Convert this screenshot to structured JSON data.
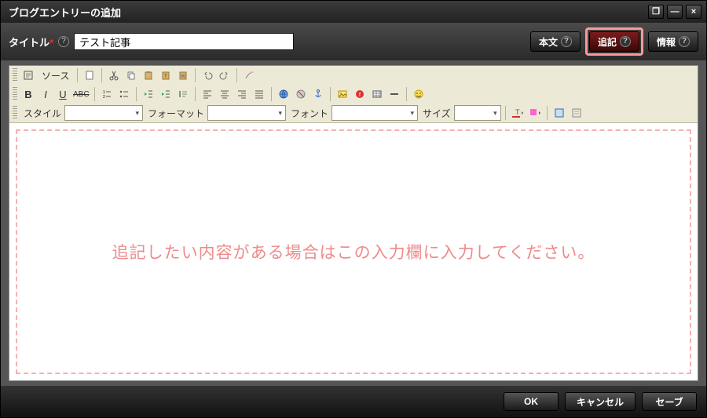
{
  "window": {
    "title": "ブログエントリーの追加"
  },
  "form": {
    "title_label": "タイトル",
    "title_required_mark": "*",
    "title_value": "テスト記事"
  },
  "tabs": {
    "body": {
      "label": "本文"
    },
    "more": {
      "label": "追記",
      "active": true
    },
    "info": {
      "label": "情報"
    }
  },
  "toolbar": {
    "source_label": "ソース",
    "style_label": "スタイル",
    "style_value": "",
    "format_label": "フォーマット",
    "format_value": "",
    "font_label": "フォント",
    "font_value": "",
    "size_label": "サイズ",
    "size_value": ""
  },
  "editor": {
    "placeholder": "追記したい内容がある場合はこの入力欄に入力してください。"
  },
  "footer": {
    "ok": "OK",
    "cancel": "キャンセル",
    "save": "セーブ"
  },
  "icons": {
    "maximize": "❐",
    "minimize": "—",
    "close": "×",
    "help": "?",
    "caret": "▾"
  }
}
